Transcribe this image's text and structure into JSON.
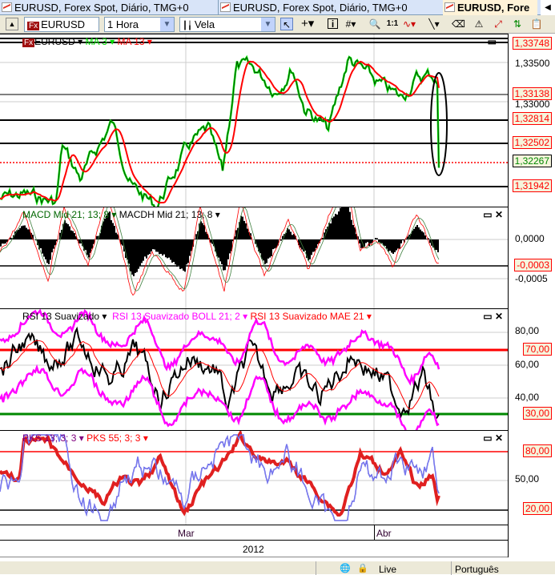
{
  "tabs": [
    {
      "label": "EURUSD, Forex Spot, Diário, TMG+0"
    },
    {
      "label": "EURUSD, Forex Spot, Diário, TMG+0"
    },
    {
      "label": "EURUSD, Fore"
    }
  ],
  "toolbar": {
    "symbol": "EURUSD",
    "symbol_badge": "Fx",
    "interval": "1 Hora",
    "chart_type": "Vela",
    "icons": [
      "pointer-icon",
      "crosshair-icon",
      "info-icon",
      "grid-icon",
      "zoom-icon",
      "one-to-one-icon",
      "indicator-icon",
      "line-tool-icon",
      "eraser-icon",
      "alert-icon",
      "fibonacci-icon",
      "compare-icon",
      "clipboard-icon"
    ],
    "one_to_one": "1:1",
    "info": "i"
  },
  "price_pane": {
    "symbol": "EURUSD",
    "ma3": "MA 3",
    "ma13": "MA 13",
    "colors": {
      "ma3": "#00dd00",
      "ma13": "#ff0000"
    },
    "levels": [
      "1,33748",
      "1,33138",
      "1,32814",
      "1,32502",
      "1,31942"
    ],
    "current": "1,32267",
    "ticks": [
      "1,33500",
      "1,33000"
    ]
  },
  "macd_pane": {
    "macd": "MACD Mid  21; 13; 8",
    "macdh": "MACDH Mid  21; 13; 8",
    "ticks": [
      "0,0000",
      "-0,0005"
    ],
    "current": "-0,0003"
  },
  "rsi_pane": {
    "rsi": "RSI 13 Suavizado",
    "boll": "RSI 13 Suavizado BOLL 21; 2",
    "mae": "RSI 13 Suavizado MAE 21",
    "ticks": [
      "80,00",
      "60,00",
      "40,00"
    ],
    "levels": [
      "70,00",
      "30,00"
    ],
    "colors": {
      "boll": "#ff00ff",
      "mae": "#ff0000",
      "upper": "#ff0000",
      "lower": "#008000"
    }
  },
  "stoch_pane": {
    "pks13": "PKS 13; 3; 3",
    "pks55": "PKS 55; 3; 3",
    "ticks": [
      "50,00"
    ],
    "levels": [
      "80,00",
      "20,00"
    ]
  },
  "time_axis": {
    "months": [
      "Mar",
      "Abr"
    ],
    "year": "2012"
  },
  "status": {
    "connection": "Live",
    "language": "Português"
  }
}
